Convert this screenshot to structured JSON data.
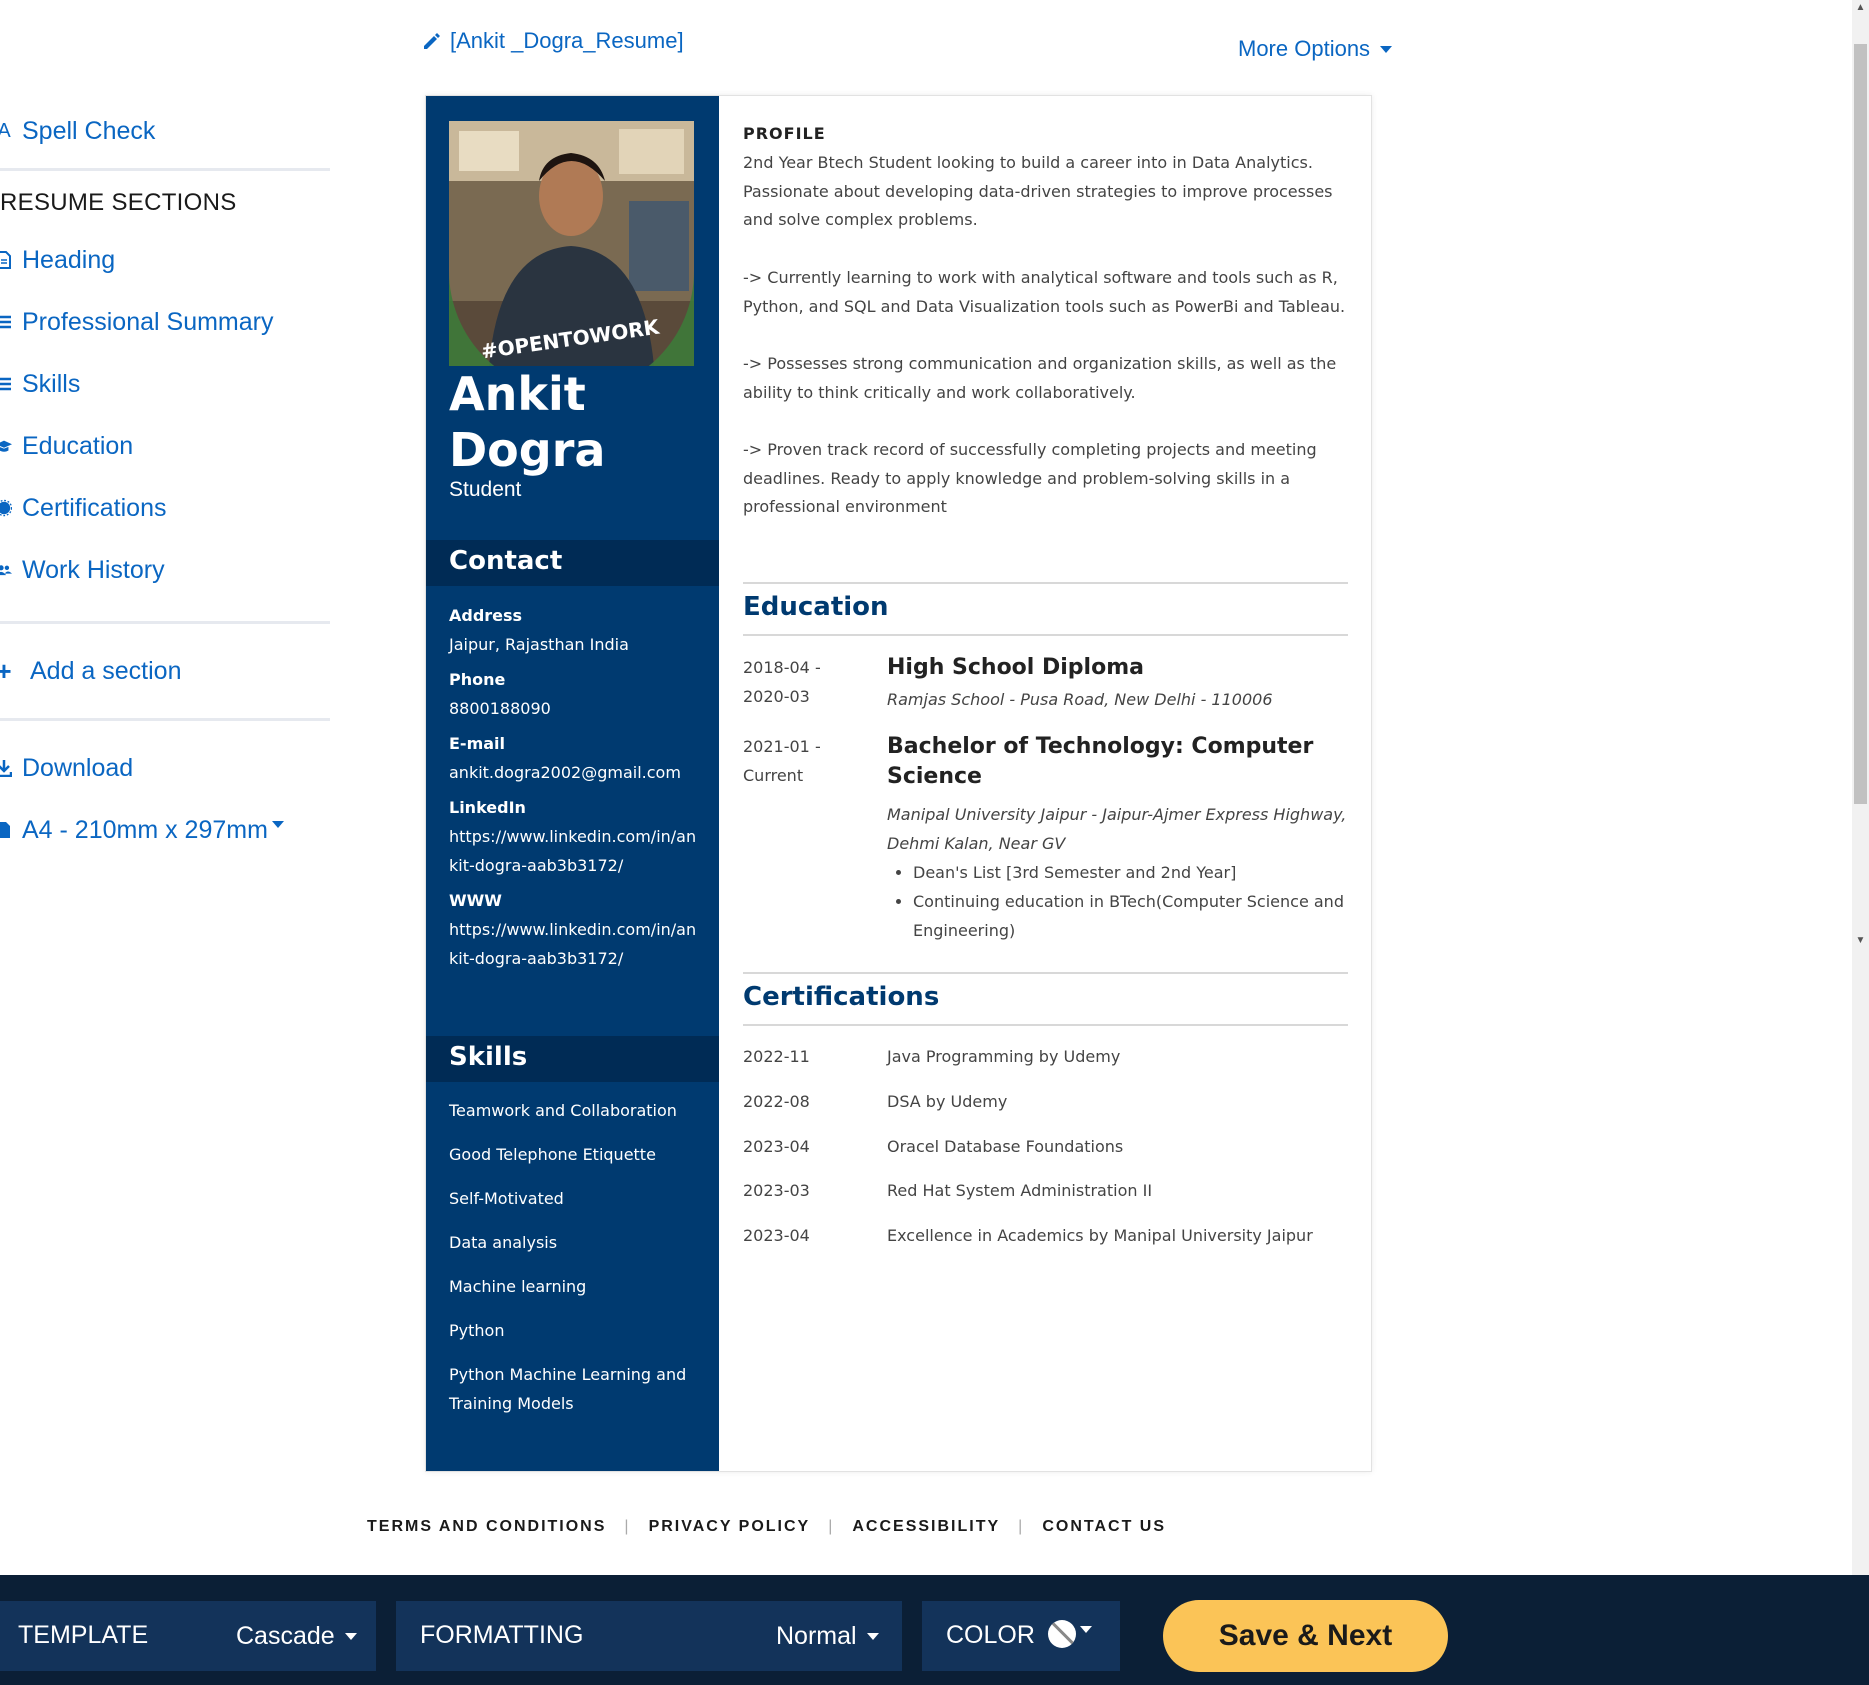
{
  "header": {
    "doc_title": "[Ankit _Dogra_Resume]",
    "more_options": "More Options"
  },
  "sidebar": {
    "spell_check": "Spell Check",
    "sections_heading": "RESUME SECTIONS",
    "items": [
      {
        "label": "Heading",
        "icon": "document-icon"
      },
      {
        "label": "Professional Summary",
        "icon": "lines-icon"
      },
      {
        "label": "Skills",
        "icon": "lines-icon"
      },
      {
        "label": "Education",
        "icon": "graduation-cap-icon"
      },
      {
        "label": "Certifications",
        "icon": "badge-icon"
      },
      {
        "label": "Work History",
        "icon": "users-icon"
      }
    ],
    "add_section": "Add a section",
    "download": "Download",
    "paper_size": "A4 - 210mm x 297mm"
  },
  "resume": {
    "first_name": "Ankit",
    "last_name": "Dogra",
    "role": "Student",
    "photo_badge": "#OPENTOWORK",
    "contact_title": "Contact",
    "contact": [
      {
        "label": "Address",
        "value": "Jaipur, Rajasthan India"
      },
      {
        "label": "Phone",
        "value": "8800188090"
      },
      {
        "label": "E-mail",
        "value": "ankit.dogra2002@gmail.com"
      },
      {
        "label": "LinkedIn",
        "value": "https://www.linkedin.com/in/ankit-dogra-aab3b3172/"
      },
      {
        "label": "WWW",
        "value": "https://www.linkedin.com/in/ankit-dogra-aab3b3172/"
      }
    ],
    "skills_title": "Skills",
    "skills": [
      "Teamwork and Collaboration",
      "Good Telephone Etiquette",
      "Self-Motivated",
      "Data analysis",
      "Machine learning",
      "Python",
      "Python Machine Learning and Training Models"
    ],
    "profile_title": "PROFILE",
    "profile": [
      "2nd Year Btech Student looking to build a career into in Data Analytics. Passionate about developing data-driven strategies to improve processes and solve complex problems.",
      "-> Currently learning to work with analytical software and tools such as R, Python, and SQL and Data Visualization tools such as PowerBi and Tableau.",
      "-> Possesses strong communication and organization skills, as well as the ability to think critically and work collaboratively.",
      "-> Proven track record of successfully completing projects and meeting deadlines. Ready to apply knowledge and problem-solving skills in a professional environment"
    ],
    "education_title": "Education",
    "education": [
      {
        "dates": "2018-04 - 2020-03",
        "degree": "High School Diploma",
        "school": "Ramjas School - Pusa Road, New Delhi - 110006",
        "bullets": []
      },
      {
        "dates": "2021-01 - Current",
        "degree": "Bachelor of Technology: Computer Science",
        "school": "Manipal University Jaipur - Jaipur-Ajmer Express Highway, Dehmi Kalan, Near GV",
        "bullets": [
          "Dean's List [3rd Semester and 2nd Year]",
          "Continuing education in BTech(Computer Science and Engineering)"
        ]
      }
    ],
    "certifications_title": "Certifications",
    "certifications": [
      {
        "date": "2022-11",
        "name": "Java Programming by Udemy"
      },
      {
        "date": "2022-08",
        "name": "DSA by Udemy"
      },
      {
        "date": "2023-04",
        "name": "Oracel Database Foundations"
      },
      {
        "date": "2023-03",
        "name": "Red Hat System Administration II"
      },
      {
        "date": "2023-04",
        "name": "Excellence in Academics by Manipal University Jaipur"
      }
    ]
  },
  "footer": {
    "links": [
      "TERMS AND CONDITIONS",
      "PRIVACY POLICY",
      "ACCESSIBILITY",
      "CONTACT US"
    ]
  },
  "toolbar": {
    "template_label": "TEMPLATE",
    "template_value": "Cascade",
    "formatting_label": "FORMATTING",
    "formatting_value": "Normal",
    "color_label": "COLOR",
    "save_label": "Save & Next"
  },
  "colors": {
    "accent": "#0a66c2",
    "resume_sidebar": "#003a70",
    "toolbar_bg": "#0b1f36",
    "save_button": "#fbc457"
  }
}
